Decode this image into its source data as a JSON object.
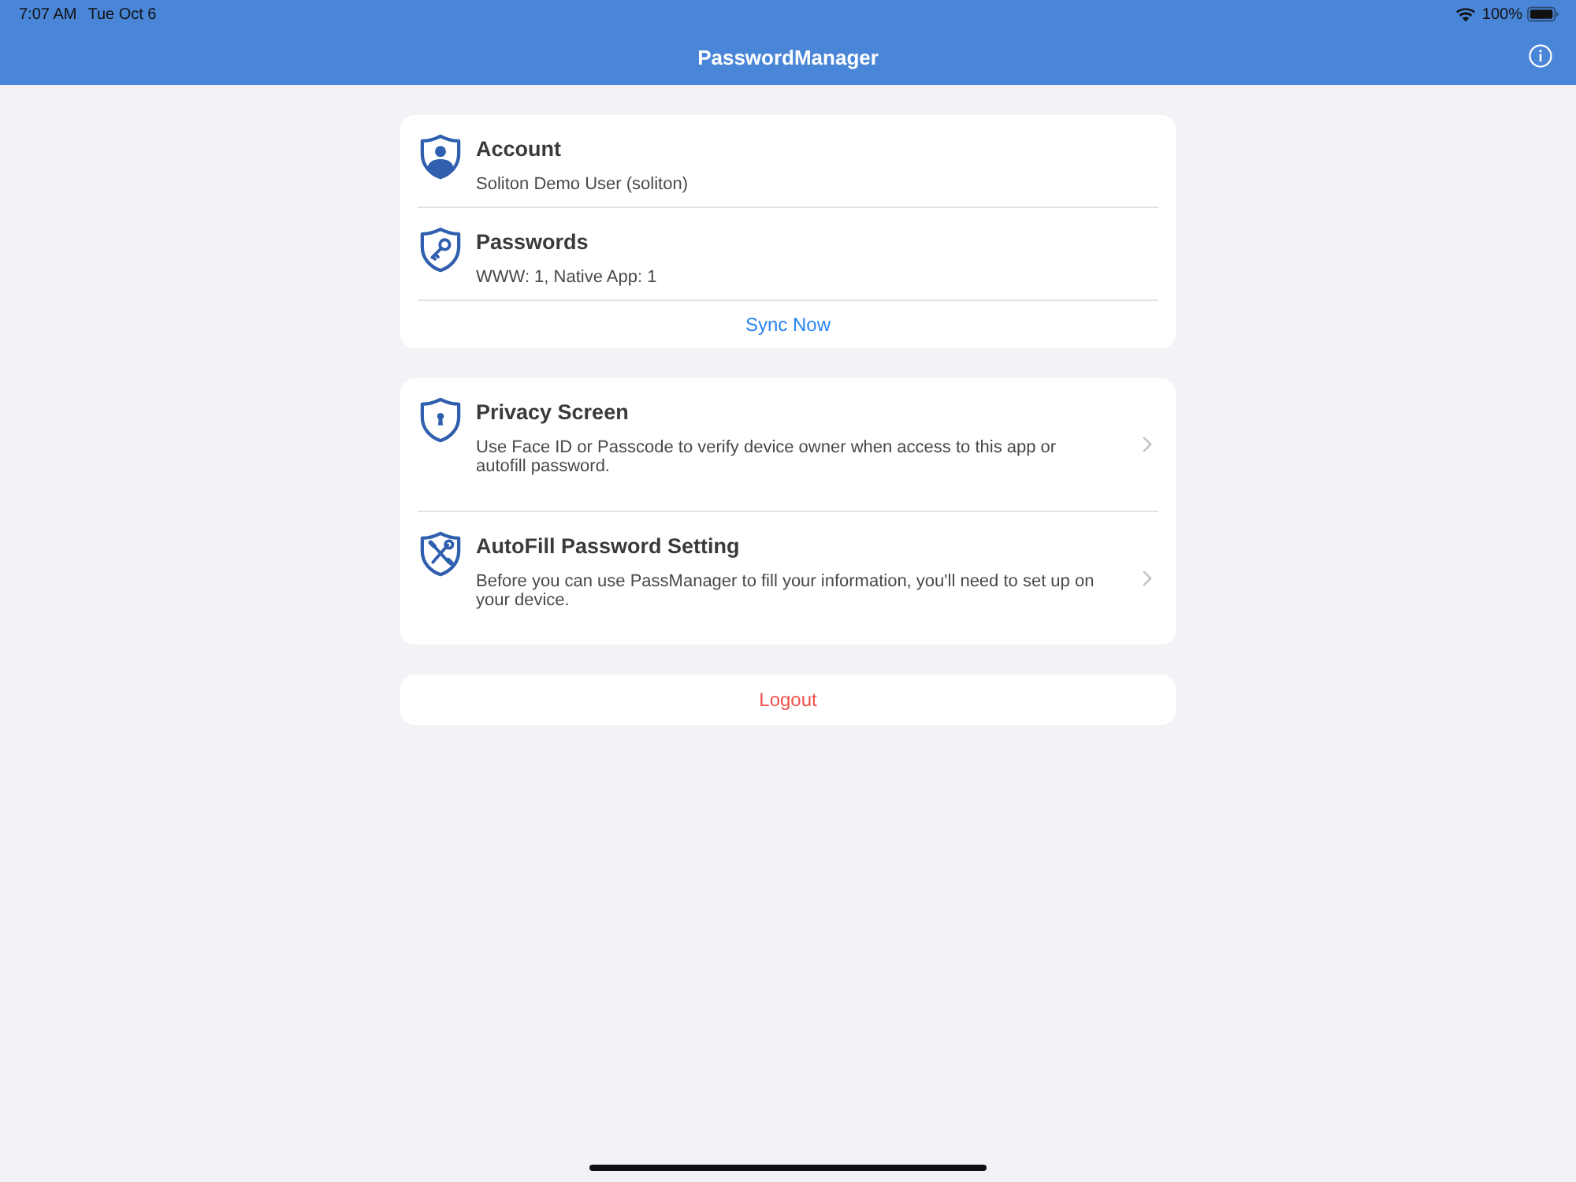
{
  "status_bar": {
    "time": "7:07 AM",
    "date": "Tue Oct 6",
    "battery": "100%"
  },
  "nav_bar": {
    "title": "PasswordManager"
  },
  "account_section": {
    "rows": [
      {
        "kind": "account",
        "title": "Account",
        "subtitle": "Soliton Demo User (soliton)"
      },
      {
        "kind": "passwords",
        "title": "Passwords",
        "subtitle": "WWW: 1, Native App: 1"
      }
    ],
    "action": "Sync Now"
  },
  "settings_section": {
    "rows": [
      {
        "kind": "privacy",
        "title": "Privacy Screen",
        "description": "Use Face ID or Passcode to verify device owner when access to this app or autofill password."
      },
      {
        "kind": "autofill",
        "title": "AutoFill Password Setting",
        "description": "Before you can use PassManager to fill your information, you'll need to set up on your device."
      }
    ]
  },
  "logout": "Logout"
}
